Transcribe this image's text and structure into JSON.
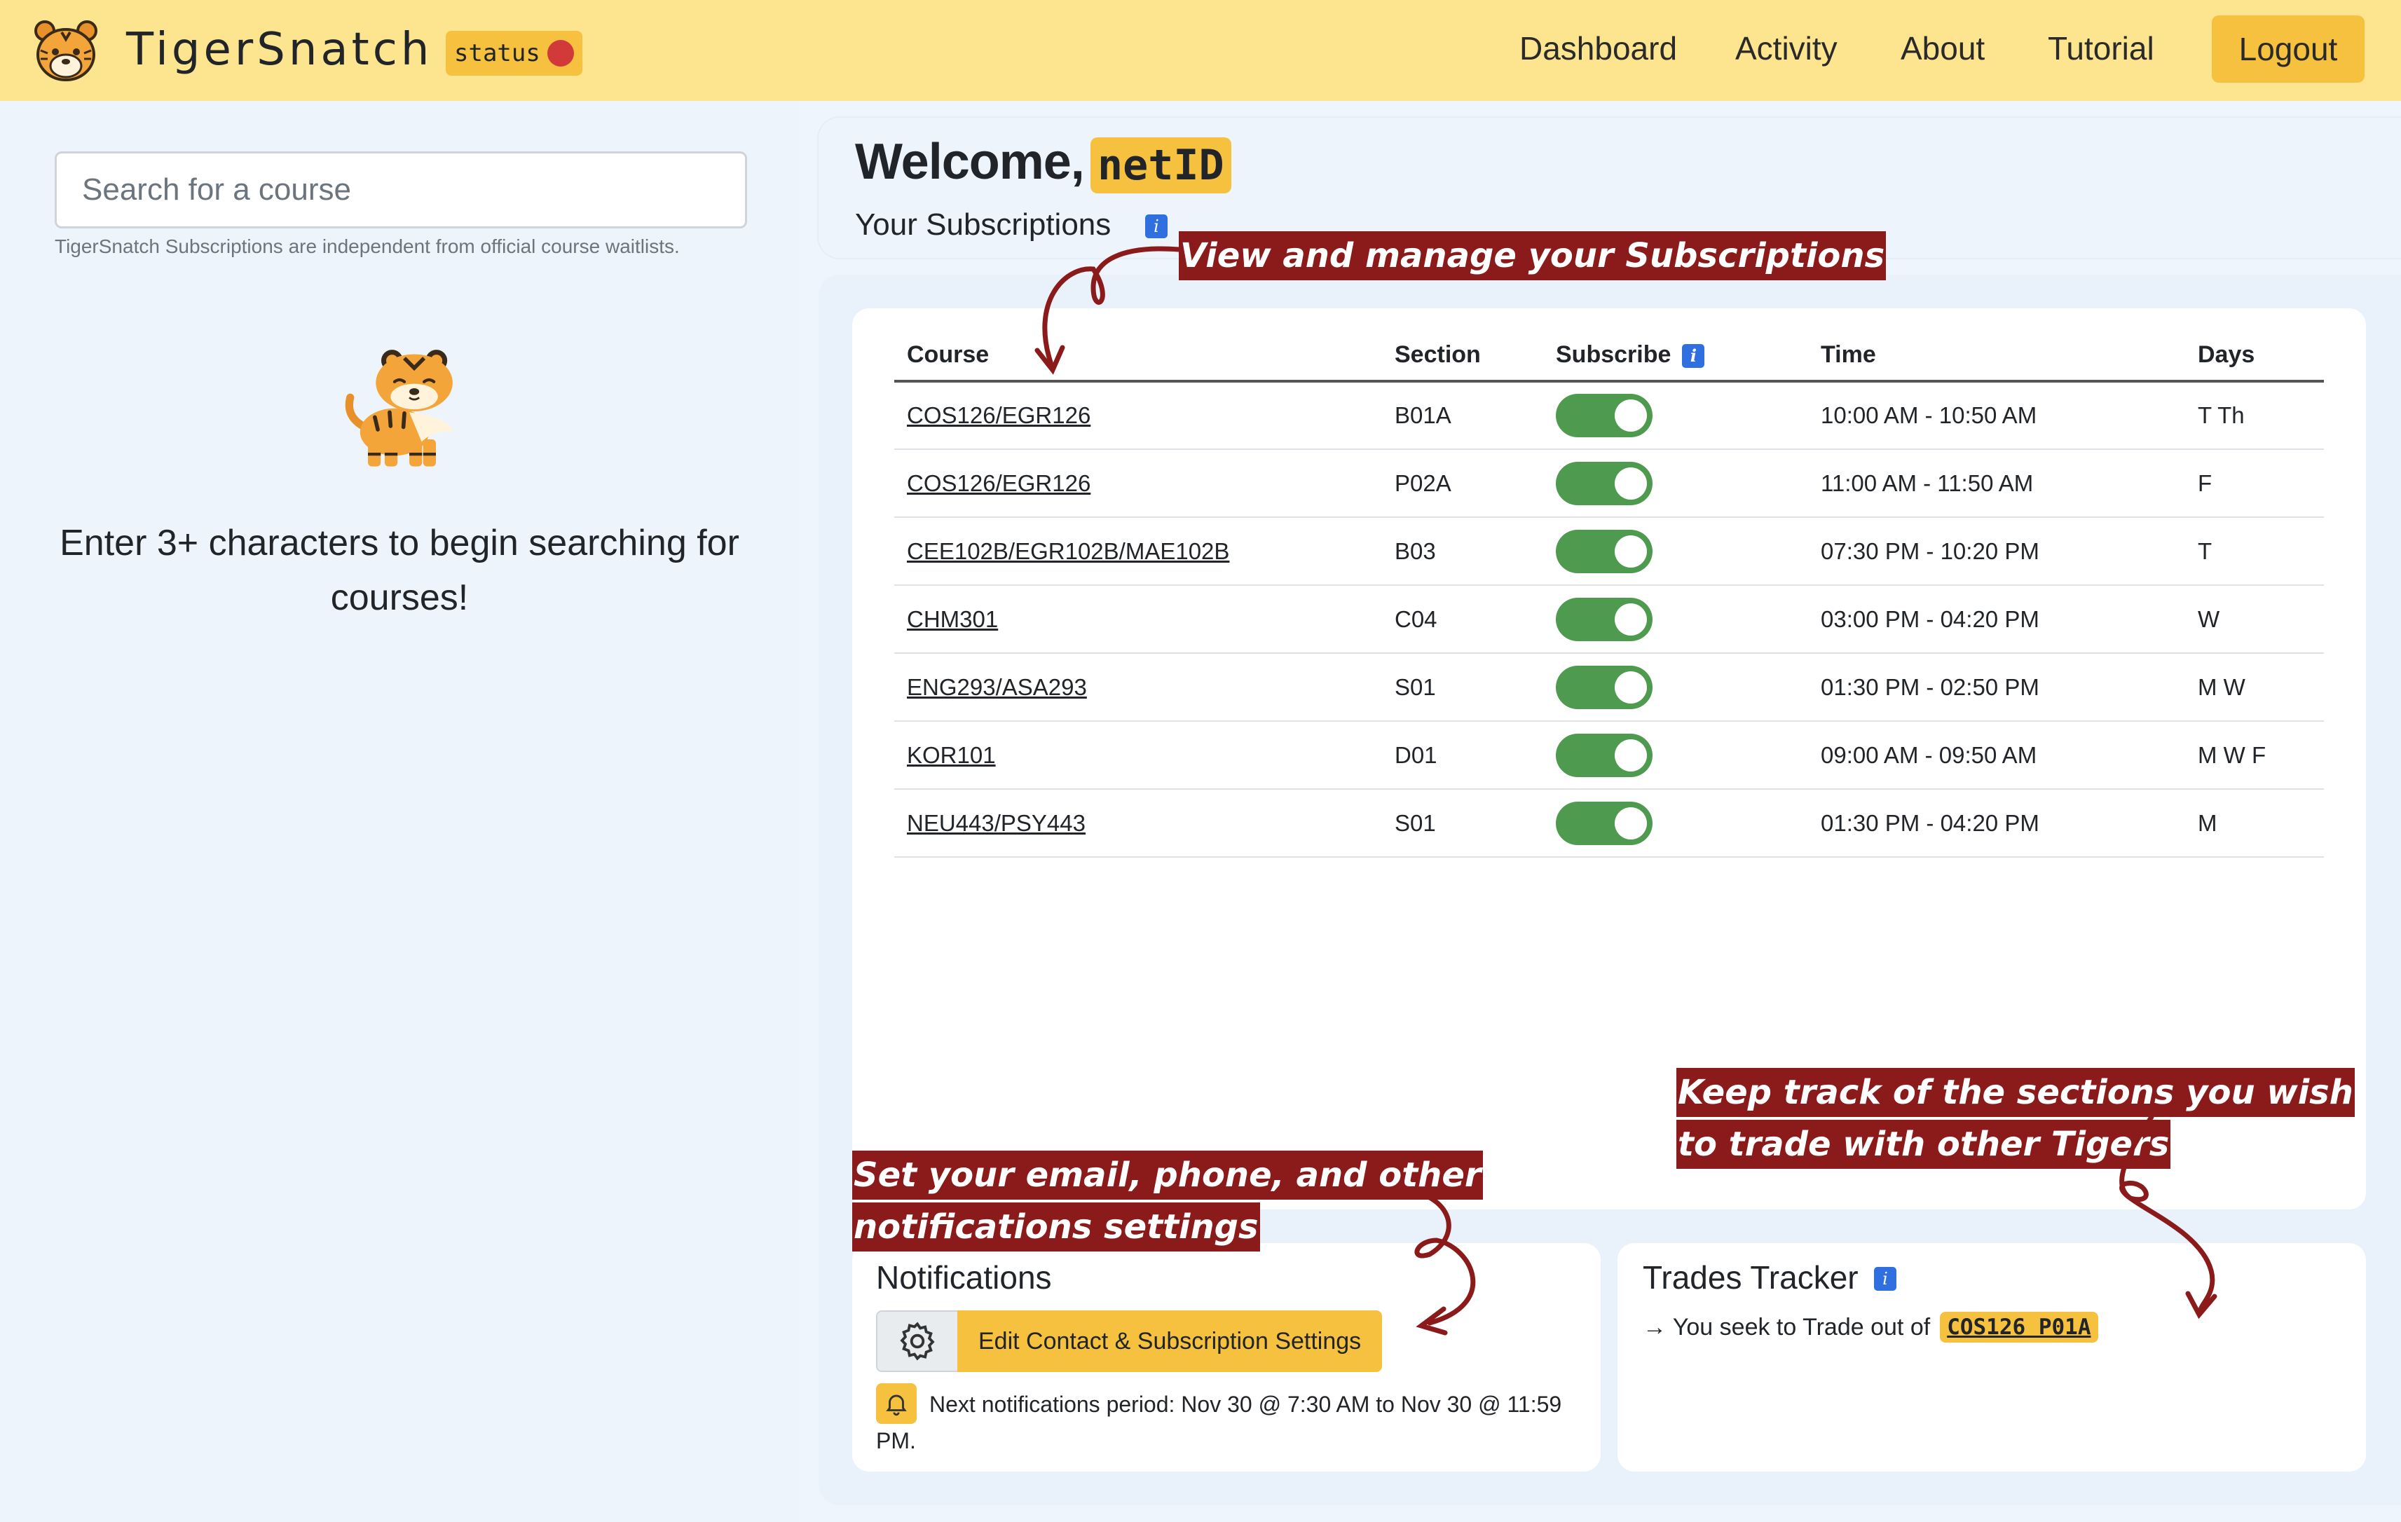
{
  "navbar": {
    "brand": "TigerSnatch",
    "status_label": "status",
    "links": [
      "Dashboard",
      "Activity",
      "About",
      "Tutorial"
    ],
    "logout_label": "Logout"
  },
  "search": {
    "placeholder": "Search for a course",
    "help_text": "TigerSnatch Subscriptions are independent from official course waitlists.",
    "prompt": "Enter 3+ characters to begin searching for courses!"
  },
  "welcome": {
    "greeting": "Welcome,",
    "netid": "netID",
    "subscriptions_heading": "Your Subscriptions"
  },
  "table": {
    "headers": {
      "course": "Course",
      "section": "Section",
      "subscribe": "Subscribe",
      "time": "Time",
      "days": "Days"
    },
    "rows": [
      {
        "course": "COS126/EGR126",
        "section": "B01A",
        "subscribed": true,
        "time": "10:00 AM - 10:50 AM",
        "days": "T Th"
      },
      {
        "course": "COS126/EGR126",
        "section": "P02A",
        "subscribed": true,
        "time": "11:00 AM - 11:50 AM",
        "days": "F"
      },
      {
        "course": "CEE102B/EGR102B/MAE102B",
        "section": "B03",
        "subscribed": true,
        "time": "07:30 PM - 10:20 PM",
        "days": "T"
      },
      {
        "course": "CHM301",
        "section": "C04",
        "subscribed": true,
        "time": "03:00 PM - 04:20 PM",
        "days": "W"
      },
      {
        "course": "ENG293/ASA293",
        "section": "S01",
        "subscribed": true,
        "time": "01:30 PM - 02:50 PM",
        "days": "M W"
      },
      {
        "course": "KOR101",
        "section": "D01",
        "subscribed": true,
        "time": "09:00 AM - 09:50 AM",
        "days": "M W F"
      },
      {
        "course": "NEU443/PSY443",
        "section": "S01",
        "subscribed": true,
        "time": "01:30 PM - 04:20 PM",
        "days": "M"
      }
    ]
  },
  "notifications": {
    "title": "Notifications",
    "settings_button": "Edit Contact & Subscription Settings",
    "period_text": "Next notifications period: Nov 30 @ 7:30 AM to Nov 30 @ 11:59 PM."
  },
  "trades": {
    "title": "Trades Tracker",
    "seek_text": "→ You seek to Trade out of",
    "trade_section": "COS126 P01A"
  },
  "annotations": {
    "subscriptions": "View and manage your Subscriptions",
    "trades_line1": "Keep track of the sections you wish",
    "trades_line2": "to trade with other Tigers",
    "notif_line1": "Set your email, phone, and other",
    "notif_line2": "notifications settings"
  },
  "colors": {
    "navbar_bg": "#fce58e",
    "accent_yellow": "#f5c13f",
    "toggle_on": "#4e9a4e",
    "annotation_red": "#8b1a1a",
    "info_blue": "#2f6fe0",
    "status_red": "#d23a3a"
  },
  "icons": {
    "logo": "tiger-face-icon",
    "settings": "gear-icon",
    "notification": "bell-icon",
    "info": "info-icon"
  }
}
